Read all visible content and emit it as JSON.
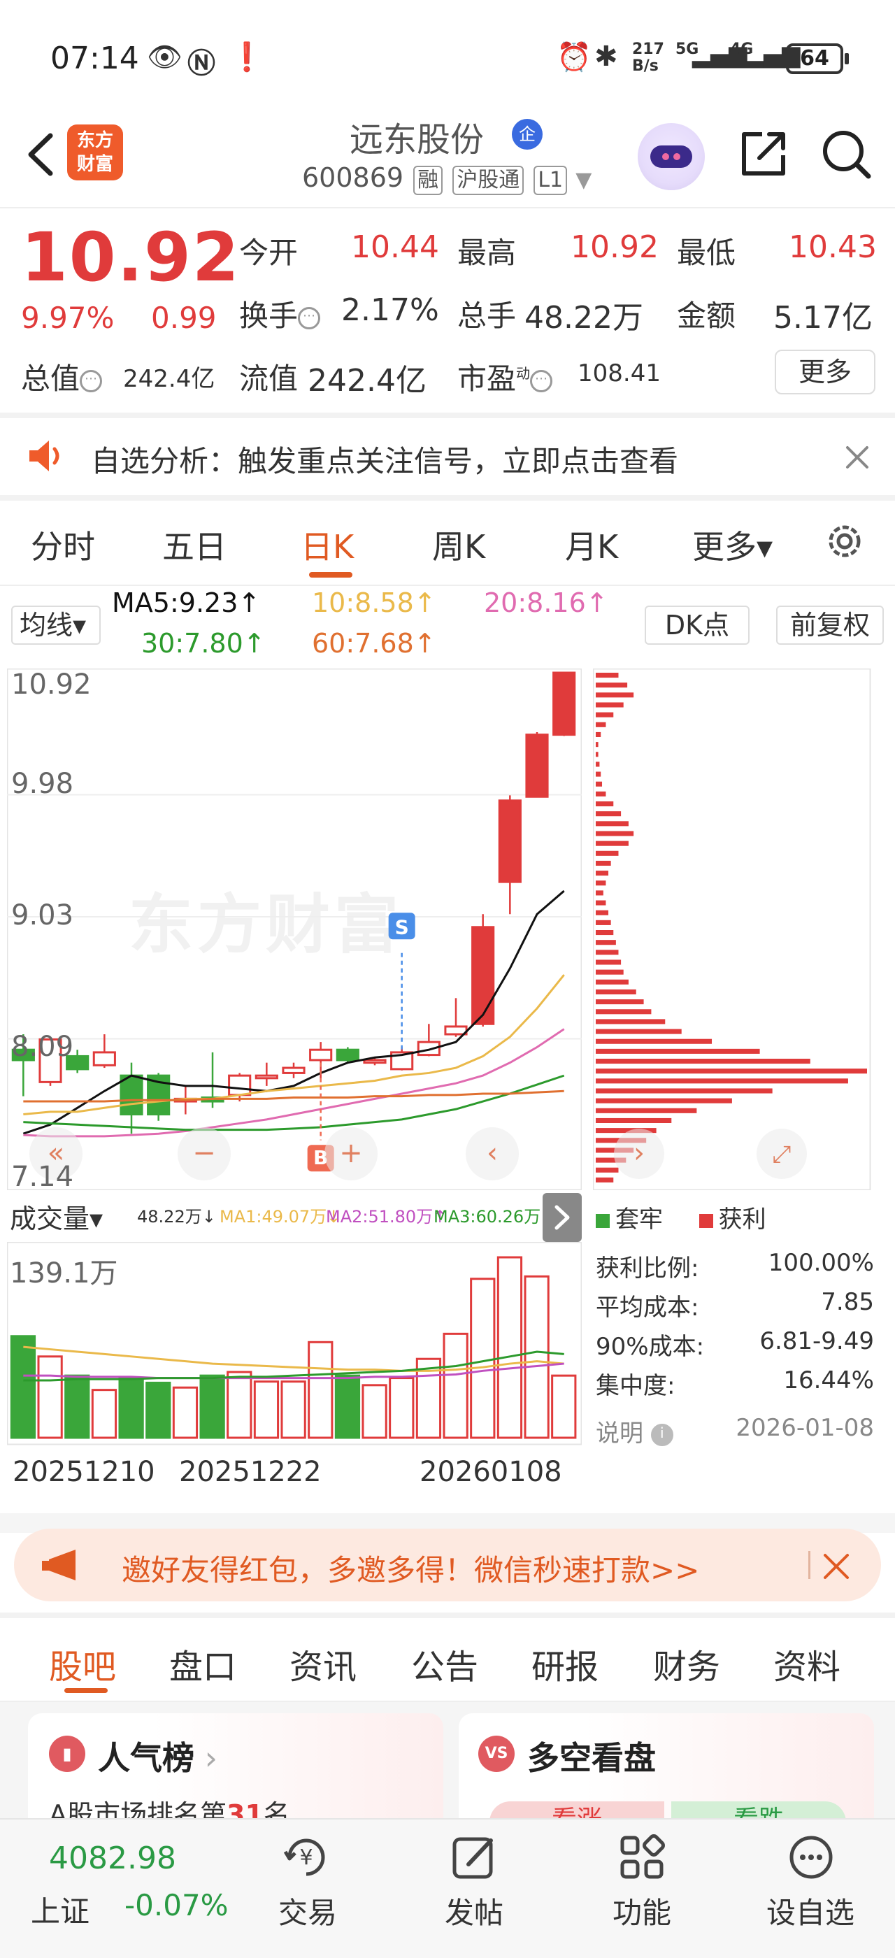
{
  "status_bar": {
    "time": "07:14",
    "net_speed_top": "217",
    "net_speed_bottom": "B/s",
    "net1": "5G",
    "net2": "4G",
    "battery": "64"
  },
  "header": {
    "logo_text_1": "东方",
    "logo_text_2": "财富",
    "stock_name": "远东股份",
    "enterprise_badge": "企",
    "stock_code": "600869",
    "tags": [
      "融",
      "沪股通",
      "L1"
    ]
  },
  "quote": {
    "price": "10.92",
    "change_pct": "9.97%",
    "change_amount": "0.99",
    "open_label": "今开",
    "open": "10.44",
    "high_label": "最高",
    "high": "10.92",
    "low_label": "最低",
    "low": "10.43",
    "turnover_label": "换手",
    "turnover": "2.17%",
    "volume_label": "总手",
    "volume": "48.22万",
    "amount_label": "金额",
    "amount": "5.17亿",
    "mktcap_label": "总值",
    "mktcap": "242.4亿",
    "float_label": "流值",
    "float": "242.4亿",
    "pe_label": "市盈",
    "pe_sup": "动",
    "pe": "108.41",
    "more": "更多"
  },
  "notice": {
    "text": "自选分析：触发重点关注信号，立即点击查看"
  },
  "period_tabs": [
    "分时",
    "五日",
    "日K",
    "周K",
    "月K",
    "更多▾"
  ],
  "active_period": "日K",
  "ma": {
    "select": "均线▾",
    "ma5": "MA5:9.23↑",
    "ma10": "10:8.58↑",
    "ma20": "20:8.16↑",
    "ma30": "30:7.80↑",
    "ma60": "60:7.68↑",
    "dk": "DK点",
    "fq": "前复权"
  },
  "colors": {
    "red": "#e03b3b",
    "green": "#3aa63a",
    "orange": "#e05a22",
    "ma5": "#111111",
    "ma10": "#eab94a",
    "ma20": "#e06bb0",
    "ma30": "#2c9a2c",
    "ma60": "#e07030"
  },
  "watermark": "东方财富",
  "chart_data": {
    "type": "candlestick",
    "price_axis_ticks": [
      "10.92",
      "9.98",
      "9.03",
      "8.09",
      "7.14"
    ],
    "ylim": [
      7.14,
      10.92
    ],
    "candles": [
      {
        "o": 8.0,
        "c": 7.92,
        "h": 8.12,
        "l": 7.64
      },
      {
        "o": 7.75,
        "c": 8.08,
        "h": 8.1,
        "l": 7.72
      },
      {
        "o": 7.95,
        "c": 7.85,
        "h": 8.0,
        "l": 7.82
      },
      {
        "o": 7.88,
        "c": 7.98,
        "h": 8.12,
        "l": 7.86
      },
      {
        "o": 7.8,
        "c": 7.5,
        "h": 7.9,
        "l": 7.35
      },
      {
        "o": 7.8,
        "c": 7.5,
        "h": 7.82,
        "l": 7.45
      },
      {
        "o": 7.6,
        "c": 7.62,
        "h": 7.72,
        "l": 7.5
      },
      {
        "o": 7.63,
        "c": 7.6,
        "h": 7.98,
        "l": 7.55
      },
      {
        "o": 7.65,
        "c": 7.8,
        "h": 7.82,
        "l": 7.6
      },
      {
        "o": 7.78,
        "c": 7.8,
        "h": 7.9,
        "l": 7.72
      },
      {
        "o": 7.82,
        "c": 7.86,
        "h": 7.9,
        "l": 7.78
      },
      {
        "o": 7.92,
        "c": 8.0,
        "h": 8.06,
        "l": 7.78
      },
      {
        "o": 8.0,
        "c": 7.92,
        "h": 8.02,
        "l": 7.9
      },
      {
        "o": 7.9,
        "c": 7.92,
        "h": 7.94,
        "l": 7.88
      },
      {
        "o": 7.85,
        "c": 7.98,
        "h": 8.02,
        "l": 7.84
      },
      {
        "o": 7.96,
        "c": 8.06,
        "h": 8.2,
        "l": 7.95
      },
      {
        "o": 8.12,
        "c": 8.18,
        "h": 8.4,
        "l": 8.1
      },
      {
        "o": 8.2,
        "c": 8.95,
        "h": 9.05,
        "l": 8.18
      },
      {
        "o": 9.3,
        "c": 9.93,
        "h": 9.97,
        "l": 9.05
      },
      {
        "o": 9.96,
        "c": 10.44,
        "h": 10.46,
        "l": 9.96
      },
      {
        "o": 10.44,
        "c": 10.92,
        "h": 10.92,
        "l": 10.43
      }
    ],
    "ma_lines": {
      "MA5": [
        7.35,
        7.42,
        7.55,
        7.68,
        7.8,
        7.75,
        7.72,
        7.72,
        7.7,
        7.68,
        7.72,
        7.82,
        7.9,
        7.94,
        7.96,
        8.0,
        8.06,
        8.27,
        8.63,
        9.05,
        9.23
      ],
      "MA10": [
        7.5,
        7.52,
        7.52,
        7.55,
        7.58,
        7.6,
        7.62,
        7.62,
        7.65,
        7.68,
        7.7,
        7.72,
        7.74,
        7.76,
        7.8,
        7.82,
        7.86,
        7.95,
        8.1,
        8.32,
        8.58
      ],
      "MA20": [
        7.34,
        7.33,
        7.33,
        7.33,
        7.34,
        7.35,
        7.37,
        7.4,
        7.43,
        7.46,
        7.5,
        7.54,
        7.58,
        7.62,
        7.66,
        7.7,
        7.74,
        7.8,
        7.9,
        8.02,
        8.16
      ],
      "MA30": [
        7.44,
        7.43,
        7.42,
        7.41,
        7.4,
        7.39,
        7.38,
        7.38,
        7.38,
        7.38,
        7.39,
        7.4,
        7.42,
        7.44,
        7.46,
        7.5,
        7.54,
        7.6,
        7.66,
        7.73,
        7.8
      ],
      "MA60": [
        7.6,
        7.6,
        7.6,
        7.6,
        7.61,
        7.61,
        7.61,
        7.62,
        7.62,
        7.62,
        7.63,
        7.63,
        7.63,
        7.64,
        7.64,
        7.65,
        7.65,
        7.66,
        7.66,
        7.67,
        7.68
      ]
    },
    "markers": [
      {
        "label": "S",
        "index": 14
      },
      {
        "label": "B",
        "index": 11
      }
    ],
    "volume": {
      "header": "成交量▾",
      "legend": [
        "48.22万↓",
        "MA1:49.07万↓",
        "MA2:51.80万↑",
        "MA3:60.26万↓"
      ],
      "max_label": "139.1万",
      "values": [
        85,
        68,
        52,
        40,
        50,
        46,
        42,
        52,
        55,
        47,
        47,
        80,
        52,
        44,
        50,
        66,
        87,
        133,
        151,
        135,
        52
      ]
    },
    "dates": [
      "20251210",
      "20251222",
      "20260108"
    ]
  },
  "chip": {
    "legend_trapped": "套牢",
    "legend_profit": "获利",
    "stats": [
      {
        "label": "获利比例:",
        "value": "100.00%"
      },
      {
        "label": "平均成本:",
        "value": "7.85"
      },
      {
        "label": "90%成本:",
        "value": "6.81-9.49"
      },
      {
        "label": "集中度:",
        "value": "16.44%"
      }
    ],
    "explain": "说明",
    "date": "2026-01-08",
    "distribution": [
      18,
      25,
      30,
      22,
      14,
      8,
      4,
      2,
      2,
      3,
      4,
      5,
      8,
      14,
      20,
      26,
      30,
      26,
      18,
      12,
      10,
      8,
      6,
      8,
      10,
      12,
      14,
      16,
      18,
      20,
      22,
      26,
      32,
      38,
      44,
      55,
      68,
      92,
      130,
      170,
      215,
      200,
      140,
      108,
      80,
      60,
      48,
      40,
      30,
      24,
      18,
      14
    ]
  },
  "promo": {
    "text": "邀好友得红包，多邀多得！微信秒速打款>>"
  },
  "bottom_tabs": [
    "股吧",
    "盘口",
    "资讯",
    "公告",
    "研报",
    "财务",
    "资料"
  ],
  "cards": {
    "popularity_title": "人气榜",
    "popularity_sub_prefix": "A股市场排名第",
    "popularity_rank": "31",
    "popularity_sub_suffix": "名",
    "bull_bear_title": "多空看盘",
    "bull": "看涨",
    "bear": "看跌"
  },
  "bottom_nav": {
    "index_value": "4082.98",
    "index_name": "上证",
    "index_change": "-0.07%",
    "items": [
      "交易",
      "发帖",
      "功能",
      "设自选"
    ]
  }
}
